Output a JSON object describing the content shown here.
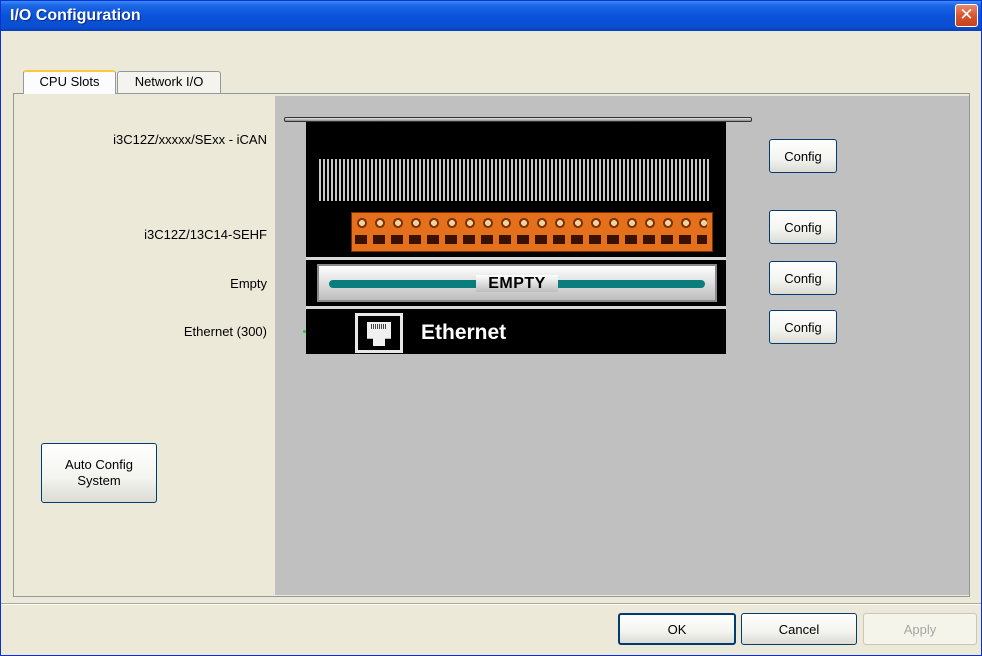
{
  "window": {
    "title": "I/O Configuration",
    "close_glyph": "✕"
  },
  "tabs": [
    {
      "label": "CPU Slots",
      "active": true
    },
    {
      "label": "Network I/O",
      "active": false
    }
  ],
  "slots": [
    {
      "label": "i3C12Z/xxxxx/SExx - iCAN",
      "config_label": "Config",
      "module": "iCAN grille"
    },
    {
      "label": "i3C12Z/13C14-SEHF",
      "config_label": "Config",
      "module": "terminal block"
    },
    {
      "label": "Empty",
      "config_label": "Config",
      "module_text": "EMPTY"
    },
    {
      "label": "Ethernet (300)",
      "config_label": "Config",
      "module_text": "Ethernet"
    }
  ],
  "auto_config": {
    "line1": "Auto Config",
    "line2": "System"
  },
  "footer": {
    "ok": "OK",
    "cancel": "Cancel",
    "apply": "Apply",
    "apply_enabled": false
  },
  "colors": {
    "title_bar": "#0a52d9",
    "terminal_block": "#e4701c",
    "empty_bar": "#0a7d7d",
    "rack_background": "#c0c0c0"
  }
}
